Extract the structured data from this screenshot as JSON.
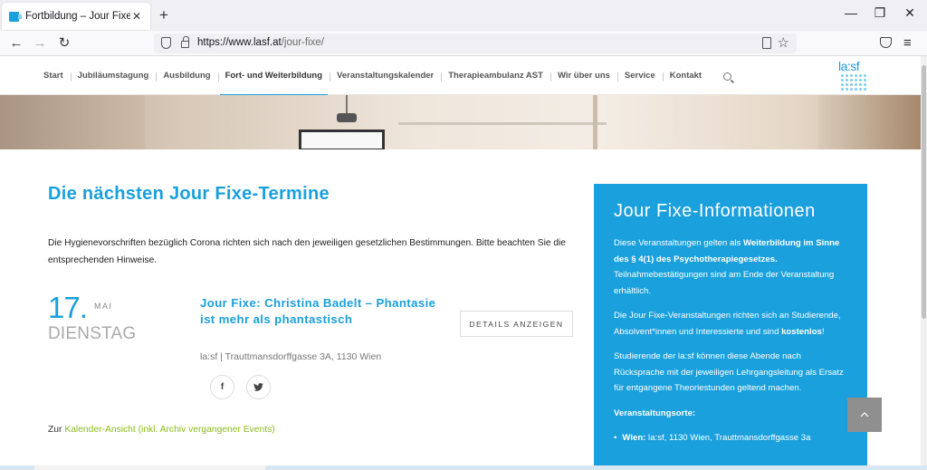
{
  "browser": {
    "tab_title": "Fortbildung – Jour Fixe - la:sf",
    "tab_close": "✕",
    "new_tab": "+",
    "url_domain": "https://www.lasf.at",
    "url_path": "/jour-fixe/",
    "back": "←",
    "forward": "→",
    "reload": "↻",
    "star": "☆",
    "menu": "≡",
    "minimize": "—",
    "maximize": "❐",
    "close": "✕"
  },
  "nav": {
    "items": [
      "Start",
      "Jubiläumstagung",
      "Ausbildung",
      "Fort- und Weiterbildung",
      "Veranstaltungskalender",
      "Therapieambulanz AST",
      "Wir über uns",
      "Service",
      "Kontakt"
    ],
    "active_index": 3
  },
  "logo": {
    "text": "la:sf"
  },
  "main": {
    "title": "Die nächsten Jour Fixe-Termine",
    "notice": "Die Hygienevorschriften bezüglich Corona richten sich nach den jeweiligen gesetzlichen Bestimmungen. Bitte beachten Sie die entsprechenden Hinweise.",
    "event": {
      "day": "17.",
      "month": "MAI",
      "weekday": "DIENSTAG",
      "title": "Jour Fixe: Christina Badelt – Phantasie ist mehr als phantastisch",
      "details_button": "DETAILS ANZEIGEN",
      "location": "la:sf | Trauttmansdorffgasse 3A, 1130 Wien",
      "share_facebook": "f",
      "share_twitter": "🐦"
    },
    "calendar_prefix": "Zur",
    "calendar_link": "Kalender-Ansicht (inkl. Archiv vergangener Events)"
  },
  "sidebar": {
    "title": "Jour Fixe-Informationen",
    "p1_a": "Diese Veranstaltungen gelten als ",
    "p1_b": "Weiterbildung im Sinne des § 4(1) des Psychotherapiegesetzes.",
    "p1_c": " Teilnahmebestätigungen sind am Ende der Veranstaltung erhältlich.",
    "p2_a": "Die Jour Fixe-Veranstaltungen richten sich an Studierende, Absolvent*innen und Interessierte und sind ",
    "p2_b": "kostenlos",
    "p2_c": "!",
    "p3": "Studierende der la:sf können diese Abende nach Rücksprache mit der jeweiligen Lehrgangsleitung als Ersatz für entgangene Theoriestunden geltend machen.",
    "orte_label": "Veranstaltungsorte:",
    "orte": [
      {
        "name": "Wien:",
        "address": " la:sf, 1130 Wien, Trauttmansdorffgasse 3a"
      }
    ]
  },
  "colors": {
    "accent": "#1aa0dc",
    "link_green": "#8dbd1a"
  },
  "icons": {
    "scroll_top": "chevron-up-icon"
  }
}
